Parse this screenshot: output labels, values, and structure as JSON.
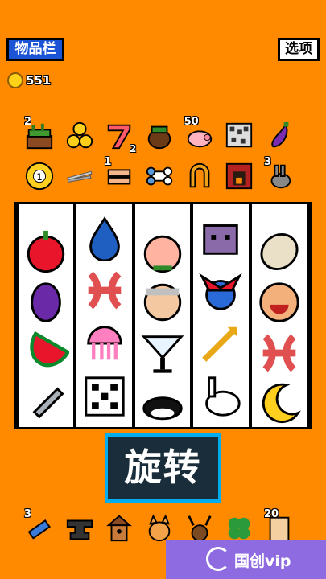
{
  "header": {
    "inventory_label": "物品栏",
    "options_label": "选项",
    "coins": "551"
  },
  "items_row1": [
    {
      "name": "planter-icon",
      "count": "2",
      "sub": ""
    },
    {
      "name": "coin-stack-icon",
      "count": "",
      "sub": ""
    },
    {
      "name": "lucky-seven-icon",
      "count": "",
      "sub": "2"
    },
    {
      "name": "basket-icon",
      "count": "",
      "sub": ""
    },
    {
      "name": "pig-icon",
      "count": "50",
      "sub": ""
    },
    {
      "name": "static-tv-icon",
      "count": "",
      "sub": ""
    },
    {
      "name": "eggplant-icon",
      "count": "",
      "sub": ""
    }
  ],
  "items_row2": [
    {
      "name": "billiard-ball-icon",
      "count": "",
      "sub": "",
      "label": "1"
    },
    {
      "name": "chopsticks-icon",
      "count": "",
      "sub": ""
    },
    {
      "name": "bandage-icon",
      "count": "1",
      "sub": ""
    },
    {
      "name": "bone-icon",
      "count": "",
      "sub": ""
    },
    {
      "name": "horseshoe-icon",
      "count": "",
      "sub": ""
    },
    {
      "name": "fireplace-icon",
      "count": "",
      "sub": ""
    },
    {
      "name": "rabbit-icon",
      "count": "3",
      "sub": ""
    }
  ],
  "reels": [
    [
      "apple",
      "grape",
      "watermelon",
      "sword"
    ],
    [
      "drop",
      "pisces",
      "jellyfish",
      "dice"
    ],
    [
      "peach",
      "grandma",
      "martini",
      "orca"
    ],
    [
      "rat",
      "jester",
      "arrow",
      "bunny"
    ],
    [
      "coconut",
      "laughing-face",
      "pisces",
      "moon"
    ]
  ],
  "spin_label": "旋转",
  "items_bottom": [
    {
      "name": "flashlight-icon",
      "count": "3"
    },
    {
      "name": "anvil-icon",
      "count": ""
    },
    {
      "name": "birdhouse-icon",
      "count": ""
    },
    {
      "name": "cat-icon",
      "count": ""
    },
    {
      "name": "deer-icon",
      "count": ""
    },
    {
      "name": "clover-icon",
      "count": ""
    },
    {
      "name": "scroll-icon",
      "count": "20"
    }
  ],
  "watermark": "国创vip"
}
